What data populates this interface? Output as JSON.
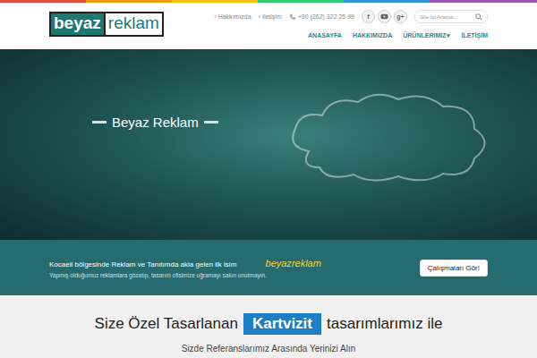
{
  "logo": {
    "left": "beyaz",
    "right": "reklam"
  },
  "top_links": [
    {
      "marker": "›",
      "label": "Hakkımızda"
    },
    {
      "marker": "›",
      "label": "İletişim"
    }
  ],
  "phone": "+90 (262) 322 25 99",
  "social": [
    {
      "kind": "glyph",
      "glyph": "f"
    },
    {
      "kind": "youtube",
      "glyph": ""
    },
    {
      "kind": "glyph",
      "glyph": "g+"
    }
  ],
  "search": {
    "placeholder": "Site İçi Arama..."
  },
  "nav": [
    {
      "label": "ANASAYFA",
      "arrow": ""
    },
    {
      "label": "HAKKIMIZDA",
      "arrow": ""
    },
    {
      "label": "ÜRÜNLERIMIZ",
      "arrow": "▾"
    },
    {
      "label": "İLETİŞİM",
      "arrow": ""
    }
  ],
  "hero": {
    "caption": "Beyaz Reklam"
  },
  "band": {
    "lead": "Kocaeli bölgesinde Reklam ve Tanıtımda akla gelen ilk isim",
    "brand_first": "beyaz",
    "brand_second": "reklam",
    "sub": "Yapmış olduğumuz reklamlara gözatıp, tasarım ofisimize uğramayı sakın unutmayın.",
    "button": "Çalışmaları Gör!"
  },
  "promo": {
    "before": "Size Özel Tasarlanan",
    "highlight": "Kartvizit",
    "after": "tasarımlarımız ile",
    "subtitle": "Sizde Referanslarımız Arasında Yerinizi Alın"
  }
}
